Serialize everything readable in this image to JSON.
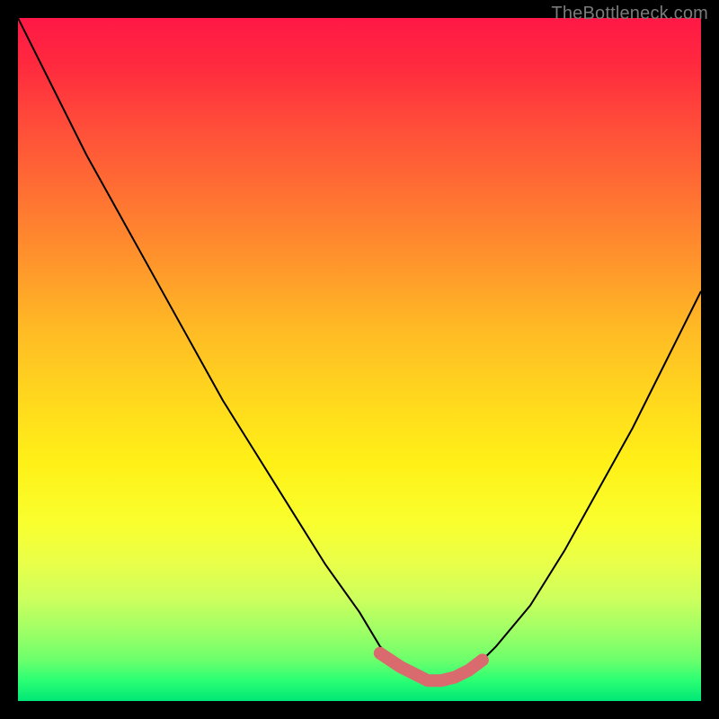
{
  "watermark": "TheBottleneck.com",
  "chart_data": {
    "type": "line",
    "title": "",
    "xlabel": "",
    "ylabel": "",
    "xlim": [
      0,
      100
    ],
    "ylim": [
      0,
      100
    ],
    "series": [
      {
        "name": "bottleneck-curve",
        "x": [
          0,
          5,
          10,
          15,
          20,
          25,
          30,
          35,
          40,
          45,
          50,
          53,
          56,
          60,
          64,
          67,
          70,
          75,
          80,
          85,
          90,
          95,
          100
        ],
        "y": [
          100,
          90,
          80,
          71,
          62,
          53,
          44,
          36,
          28,
          20,
          13,
          8,
          5,
          3,
          3,
          5,
          8,
          14,
          22,
          31,
          40,
          50,
          60
        ]
      }
    ],
    "highlight_band": {
      "name": "optimal-range",
      "x": [
        53,
        56,
        58,
        60,
        62,
        64,
        66,
        68
      ],
      "y": [
        7,
        5,
        4,
        3,
        3,
        3.5,
        4.5,
        6
      ]
    },
    "marker": {
      "x": 68,
      "y": 6
    }
  }
}
